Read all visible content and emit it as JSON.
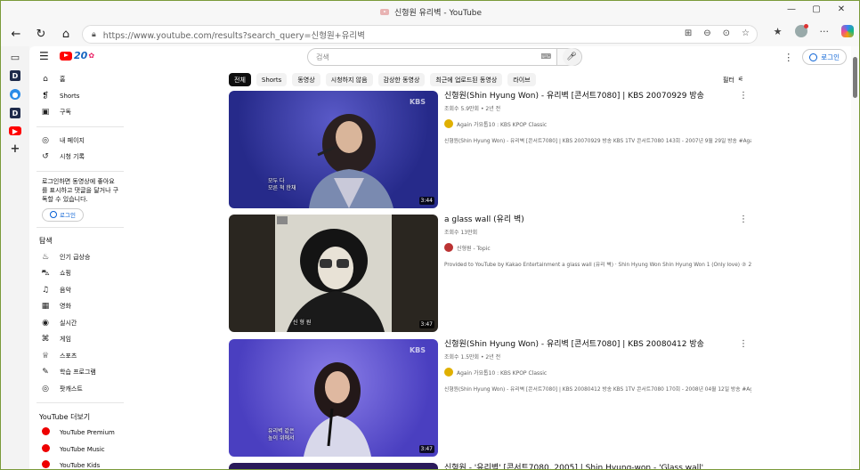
{
  "window": {
    "title": "신형원 유리벽 - YouTube"
  },
  "browser": {
    "url_domain": "https://www.youtube.com",
    "url_path": "/results?search_query=신형원+유리벽"
  },
  "youtube": {
    "logo_number": "20",
    "search_placeholder": "검색",
    "signin_label": "로그인"
  },
  "sidebar": {
    "items": [
      {
        "label": "홈",
        "icon": "home-icon"
      },
      {
        "label": "Shorts",
        "icon": "shorts-icon"
      },
      {
        "label": "구독",
        "icon": "subscriptions-icon"
      }
    ],
    "items2": [
      {
        "label": "내 페이지",
        "icon": "person-icon"
      },
      {
        "label": "시청 기록",
        "icon": "history-icon"
      }
    ],
    "signin_prompt": "로그인하면 동영상에 좋아요를 표시하고 댓글을 달거나 구독할 수 있습니다.",
    "signin_label": "로그인",
    "explore_heading": "탐색",
    "explore": [
      {
        "label": "인기 급상승",
        "icon": "trending-icon"
      },
      {
        "label": "쇼핑",
        "icon": "shopping-icon"
      },
      {
        "label": "음악",
        "icon": "music-icon"
      },
      {
        "label": "영화",
        "icon": "movie-icon"
      },
      {
        "label": "실시간",
        "icon": "live-icon"
      },
      {
        "label": "게임",
        "icon": "gaming-icon"
      },
      {
        "label": "스포츠",
        "icon": "sports-icon"
      },
      {
        "label": "학습 프로그램",
        "icon": "learning-icon"
      },
      {
        "label": "팟캐스트",
        "icon": "podcast-icon"
      }
    ],
    "more_heading": "YouTube 더보기",
    "more": [
      {
        "label": "YouTube Premium"
      },
      {
        "label": "YouTube Music"
      },
      {
        "label": "YouTube Kids"
      }
    ]
  },
  "chips": [
    "전체",
    "Shorts",
    "동영상",
    "시청하지 않음",
    "감상한 동영상",
    "최근에 업로드된 동영상",
    "라이브"
  ],
  "filter_label": "필터",
  "videos": [
    {
      "title": "신형원(Shin Hyung Won) - 유리벽 [콘서트7080] | KBS 20070929 방송",
      "meta": "조회수 5.9만회 • 2년 전",
      "channel": "Again 가요톱10 : KBS KPOP Classic",
      "desc": "신형원(Shin Hyung Won) - 유리벽 [콘서트7080] | KBS 20070929 방송 KBS 1TV 콘서트7080 143회 - 2007년 9월 29일 방송 #Again ...",
      "duration": "3:44",
      "watermark": "KBS",
      "caption": "모두 다\n모른 척 한채"
    },
    {
      "title": "a glass wall (유리 벽)",
      "meta": "조회수 13만회",
      "channel": "신형원 - Topic",
      "desc": "Provided to YouTube by Kakao Entertainment a glass wall (유리 벽) · Shin Hyung Won Shin Hyung Won 1 (Only love) ℗ 2023 ...",
      "duration": "3:47",
      "watermark": "",
      "caption": "신 형 원"
    },
    {
      "title": "신형원(Shin Hyung Won) - 유리벽 [콘서트7080] | KBS 20080412 방송",
      "meta": "조회수 1.5만회 • 2년 전",
      "channel": "Again 가요톱10 : KBS KPOP Classic",
      "desc": "신형원(Shin Hyung Won) - 유리벽 [콘서트7080] | KBS 20080412 방송 KBS 1TV 콘서트7080 170회 - 2008년 04월 12일 방송 #Again ...",
      "duration": "3:47",
      "watermark": "KBS",
      "caption": "유리벽 같은\n높이 위에서"
    },
    {
      "title": "신형원 - '유리벽' [콘서트7080, 2005] | Shin Hyung-won - 'Glass wall'",
      "meta": "",
      "channel": "",
      "desc": "",
      "duration": "",
      "watermark": "",
      "caption": ""
    }
  ]
}
